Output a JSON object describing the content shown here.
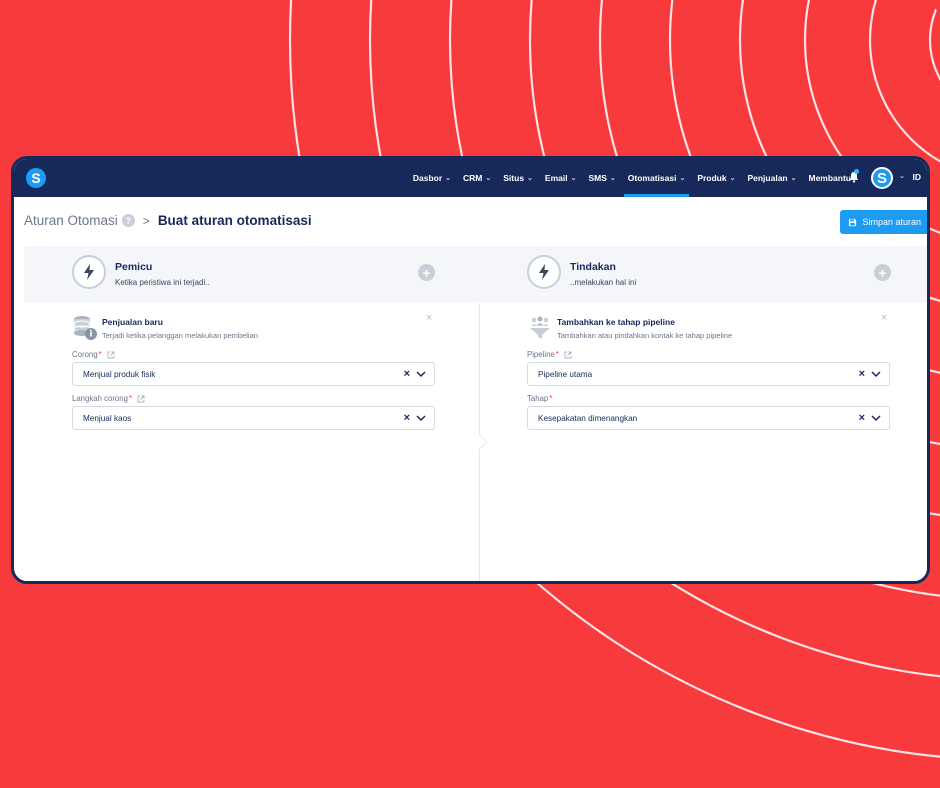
{
  "topbar": {
    "logo": "S",
    "nav": [
      {
        "label": "Dasbor",
        "active": false
      },
      {
        "label": "CRM",
        "active": false
      },
      {
        "label": "Situs",
        "active": false
      },
      {
        "label": "Email",
        "active": false
      },
      {
        "label": "SMS",
        "active": false
      },
      {
        "label": "Otomatisasi",
        "active": true
      },
      {
        "label": "Produk",
        "active": false
      },
      {
        "label": "Penjualan",
        "active": false
      },
      {
        "label": "Membantu",
        "active": false
      }
    ],
    "avatar": "S",
    "language": "ID",
    "accent_color": "#1d9bf0",
    "bar_color": "#16295a"
  },
  "breadcrumb": {
    "root": "Aturan Otomasi",
    "help": "?",
    "separator": ">",
    "current": "Buat aturan otomatisasi"
  },
  "save_button": {
    "label": "Simpan aturan",
    "icon": "floppy-disk-icon"
  },
  "trigger": {
    "title": "Pemicu",
    "subtitle": "Ketika peristiwa ini terjadi..",
    "add": "+",
    "item": {
      "title": "Penjualan baru",
      "subtitle": "Terjadi ketika pelanggan melakukan pembelian",
      "close": "×"
    },
    "fields": [
      {
        "label": "Corong",
        "required": "*",
        "value": "Menjual produk fisik"
      },
      {
        "label": "Langkah corong",
        "required": "*",
        "value": "Menjual kaos"
      }
    ]
  },
  "action": {
    "title": "Tindakan",
    "subtitle": "..melakukan hal ini",
    "add": "+",
    "item": {
      "title": "Tambahkan ke tahap pipeline",
      "subtitle": "Tambahkan atau pindahkan kontak ke tahap pipeline",
      "close": "×"
    },
    "fields": [
      {
        "label": "Pipeline",
        "required": "*",
        "value": "Pipeline utama"
      },
      {
        "label": "Tahap",
        "required": "*",
        "value": "Kesepakatan dimenangkan"
      }
    ]
  },
  "clear_symbol": "×"
}
